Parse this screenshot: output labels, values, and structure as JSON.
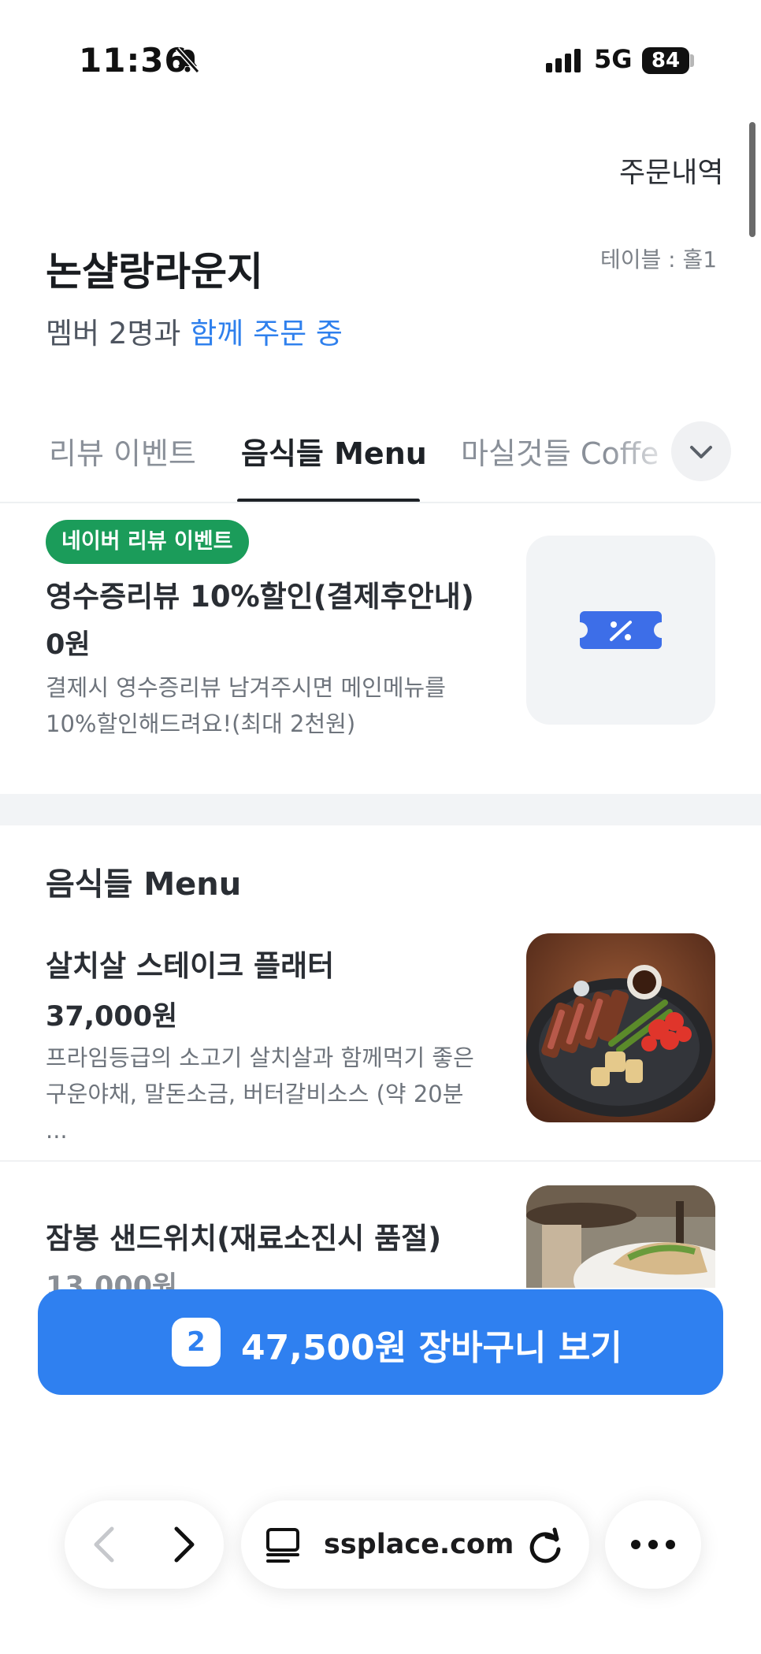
{
  "status_bar": {
    "time": "11:36",
    "network": "5G",
    "battery": "84"
  },
  "header": {
    "order_history": "주문내역",
    "store_name": "논샬랑라운지",
    "table_info": "테이블 : 홀1",
    "member_prefix": "멤버 2명과 ",
    "member_highlight": "함께 주문 중"
  },
  "tabs": [
    {
      "label": "리뷰 이벤트",
      "active": false
    },
    {
      "label": "음식들 Menu",
      "active": true
    },
    {
      "label": "마실것들 Coffe",
      "active": false
    }
  ],
  "event": {
    "badge": "네이버 리뷰 이벤트",
    "title": "영수증리뷰 10%할인(결제후안내)",
    "price": "0원",
    "desc_line1": "결제시 영수증리뷰 남겨주시면 메인메뉴를",
    "desc_line2": "10%할인해드려요!(최대 2천원)",
    "icon": "coupon-icon"
  },
  "menu_section": {
    "title": "음식들 Menu",
    "items": [
      {
        "name": "살치살 스테이크 플래터",
        "price": "37,000원",
        "desc_line1": "프라임등급의 소고기 살치살과 함께먹기 좋은",
        "desc_line2": "구운야채, 말돈소금, 버터갈비소스 (약 20분 ..."
      },
      {
        "name": "잠봉 샌드위치(재료소진시 품절)",
        "price": "13,000원"
      }
    ]
  },
  "cart": {
    "count": "2",
    "label": "47,500원 장바구니 보기",
    "color": "#2f80f0"
  },
  "browser": {
    "url": "ssplace.com"
  }
}
